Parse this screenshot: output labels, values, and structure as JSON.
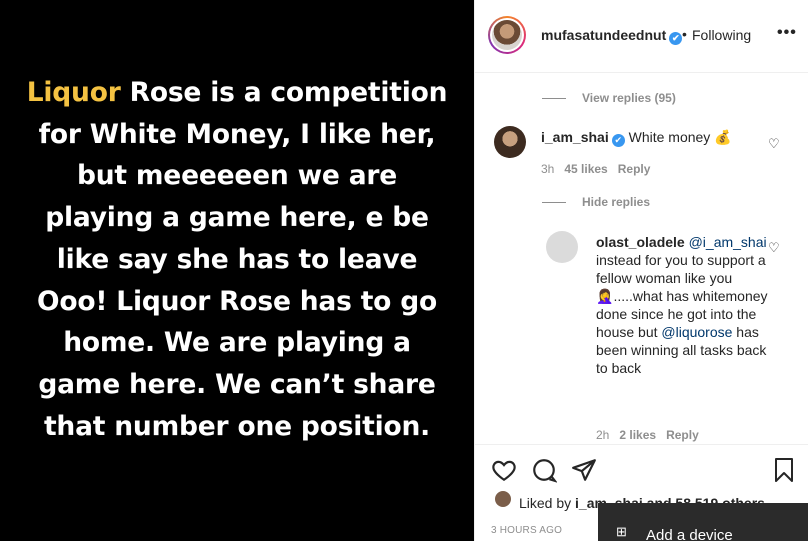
{
  "post": {
    "text_highlight": "Liquor",
    "text_rest": " Rose is a competition for White Money, I like her, but meeeeeen we are playing a game here, e be like say she has to leave Ooo! Liquor Rose has to go home. We are playing a game here. We can’t share that number one position."
  },
  "header": {
    "username": "mufasatundeednut",
    "verified_icon": "✔",
    "separator": "•",
    "follow_status": "Following",
    "more_icon": "•••"
  },
  "comments": {
    "view_replies": "View replies (95)",
    "comment1": {
      "user": "i_am_shai",
      "text": "White money",
      "emoji": "💰",
      "time": "3h",
      "likes": "45 likes",
      "reply": "Reply"
    },
    "hide_replies": "Hide replies",
    "comment2": {
      "user": "olast_oladele",
      "mention1": "@i_am_shai",
      "text1": " instead for you to support a fellow woman like you ",
      "emoji": "🤦‍♀️",
      "text2": ".....what has whitemoney done since he got into the house but ",
      "mention2": "@liquorose",
      "text3": " has been winning all tasks back to back",
      "time": "2h",
      "likes": "2 likes",
      "reply": "Reply"
    }
  },
  "actions": {
    "liked_prefix": "Liked by ",
    "liked_user": "i_am_shai",
    "liked_suffix": " and 58,519 others",
    "timestamp": "3 HOURS AGO"
  },
  "toast": {
    "label": "Add a device",
    "icon": "⊞"
  },
  "colors": {
    "highlight": "#f4c242",
    "verified": "#3897f0",
    "mention": "#00376b"
  }
}
